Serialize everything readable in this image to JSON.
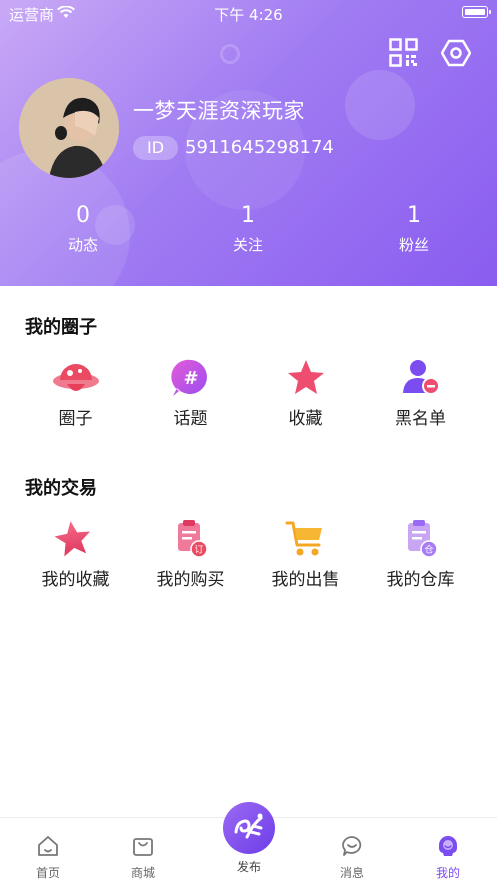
{
  "status_bar": {
    "carrier": "运营商",
    "time": "下午 4:26"
  },
  "profile": {
    "username": "一梦天涯资深玩家",
    "id_label": "ID",
    "id_value": "5911645298174",
    "stats": [
      {
        "value": "0",
        "label": "动态"
      },
      {
        "value": "1",
        "label": "关注"
      },
      {
        "value": "1",
        "label": "粉丝"
      }
    ]
  },
  "circle_section": {
    "title": "我的圈子",
    "items": [
      {
        "label": "圈子",
        "icon": "planet-icon"
      },
      {
        "label": "话题",
        "icon": "hashtag-icon"
      },
      {
        "label": "收藏",
        "icon": "star-icon"
      },
      {
        "label": "黑名单",
        "icon": "user-block-icon"
      }
    ]
  },
  "trade_section": {
    "title": "我的交易",
    "items": [
      {
        "label": "我的收藏",
        "icon": "star-icon"
      },
      {
        "label": "我的购买",
        "icon": "order-clipboard-icon"
      },
      {
        "label": "我的出售",
        "icon": "shopping-cart-icon"
      },
      {
        "label": "我的仓库",
        "icon": "warehouse-clipboard-icon"
      }
    ]
  },
  "tab_bar": {
    "items": [
      {
        "label": "首页",
        "icon": "home-icon"
      },
      {
        "label": "商城",
        "icon": "shopping-bag-icon"
      },
      {
        "label": "发布",
        "icon": "publish-icon"
      },
      {
        "label": "消息",
        "icon": "chat-bubble-icon"
      },
      {
        "label": "我的",
        "icon": "profile-icon",
        "active": true
      }
    ]
  },
  "colors": {
    "accent": "#7b4cef",
    "header_start": "#c9a9f6",
    "header_end": "#8a5cf0",
    "pink": "#ef4d6f"
  }
}
